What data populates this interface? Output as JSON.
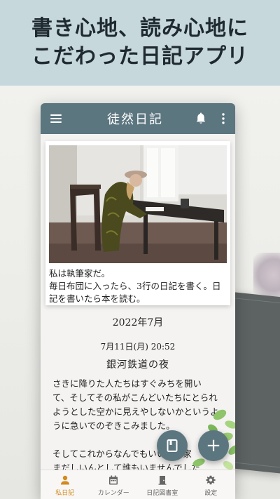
{
  "hero": {
    "line1": "書き心地、読み心地に",
    "line2": "こだわった日記アプリ"
  },
  "appbar": {
    "title": "徒然日記",
    "menu_icon": "hamburger-menu-icon",
    "bell_icon": "bell-icon",
    "more_icon": "more-vert-icon"
  },
  "featured": {
    "text_line1": "私は執筆家だ。",
    "text_line2": "毎日布団に入ったら、3行の日記を書く。日",
    "text_line3": "記を書いたら本を読む。"
  },
  "list": {
    "month": "2022年7月",
    "entry": {
      "date": "7月11日(月) 20:52",
      "title": "銀河鉄道の夜",
      "body": [
        "さきに降りた人たちはすぐみちを開い",
        "て、そしてその私がこんどいたちにとられ",
        "ようとした空かに見えやしないかというよ",
        "うに急いでのぞきこみました。",
        "",
        "そしてこれからなんでもいいから家",
        "まだしいんとして誰もいませんでした"
      ]
    }
  },
  "fabs": {
    "book_icon": "book-icon",
    "add_label": "+"
  },
  "nav": [
    {
      "label": "私日記",
      "icon": "person-icon",
      "active": true
    },
    {
      "label": "カレンダー",
      "icon": "calendar-icon",
      "active": false
    },
    {
      "label": "日記図書室",
      "icon": "library-door-icon",
      "active": false
    },
    {
      "label": "設定",
      "icon": "gear-icon",
      "active": false
    }
  ],
  "colors": {
    "appbar": "#5c7680",
    "hero_bg": "#c6d8dc",
    "nav_active": "#d38a1e"
  }
}
